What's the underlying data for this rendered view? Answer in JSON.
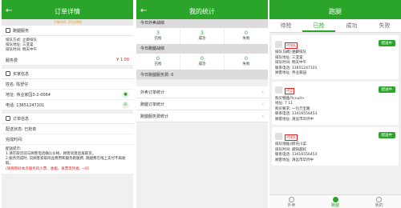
{
  "p1": {
    "title": "订单详情",
    "notice": "下单时间: 35分钟前",
    "sec_service": "跑腿服务",
    "service_lines": [
      "排队方式: 立即排队",
      "排队地址: 三亚棠",
      "排队时间: 明天中午"
    ],
    "fee_label": "服务费",
    "fee_value": "¥ 1.00",
    "sec_buyer": "买家信息",
    "name_label": "姓名: 陈舒仔",
    "addr_label": "地址: 伟业家园3-2-0064",
    "phone_label": "电话: 13651247101",
    "sec_order": "订单信息",
    "delivery_status": "配送状态: 已抢单",
    "done_time": "完成时间:",
    "tips_label": "配送提示:",
    "tip1": "1.请在取货前与顾客电话确认价格、顾客同意后再取货。",
    "tip2": "2.服务完成时, 向顾客索取商品费用和服务跑腿费, 跑腿费在线上支付不再收取。",
    "warn": "(请保管好本次服务的小票、收据、发票等凭据, 一同"
  },
  "p2": {
    "title": "我的统计",
    "today_takeout": "今日外卖战绩",
    "takeout": [
      {
        "n": "3",
        "l": "已抢"
      },
      {
        "n": "3",
        "l": "成功"
      },
      {
        "n": "0",
        "l": "失败"
      }
    ],
    "today_run": "今日跑腿战绩",
    "run": [
      {
        "n": "0",
        "l": "已抢"
      },
      {
        "n": "0",
        "l": "成功"
      },
      {
        "n": "0",
        "l": "失败"
      }
    ],
    "run_fee": "今日跑腿服务费: 0",
    "nav": [
      "外卖订单统计",
      "跑腿订单统计",
      "跑腿服务费统计"
    ]
  },
  "p3": {
    "title": "跑腿",
    "tabs": [
      "待抢",
      "已抢",
      "成功",
      "失败"
    ],
    "cards": [
      {
        "tag": "代排队",
        "dist": "35分钟前",
        "badge": "配送中",
        "lines": [
          "排队方式: 立即排队",
          "排队地址: 三亚棠",
          "排队时间: 明天中午",
          "联系电话: 13651247101",
          "顾客地址: 伟业家园"
        ]
      },
      {
        "tag": "代买",
        "dist": "1天前",
        "badge": "配送中",
        "lines": [
          "购买物品: <null>",
          "地址: 7 11",
          "购买要求: 一包万宝路",
          "联系电话: 13416556453",
          "顾客地址: 清远市华侨中"
        ]
      },
      {
        "tag": "代排队",
        "dist": "1天前",
        "badge": "配送中",
        "lines": [
          "排队地址: 缪氏川菜",
          "排队时间: 越快越好",
          "联系电话: 13416556453",
          "顾客地址: 清远市华侨中"
        ]
      }
    ],
    "tabbar": [
      "外卖",
      "跑腿",
      "我的"
    ]
  }
}
